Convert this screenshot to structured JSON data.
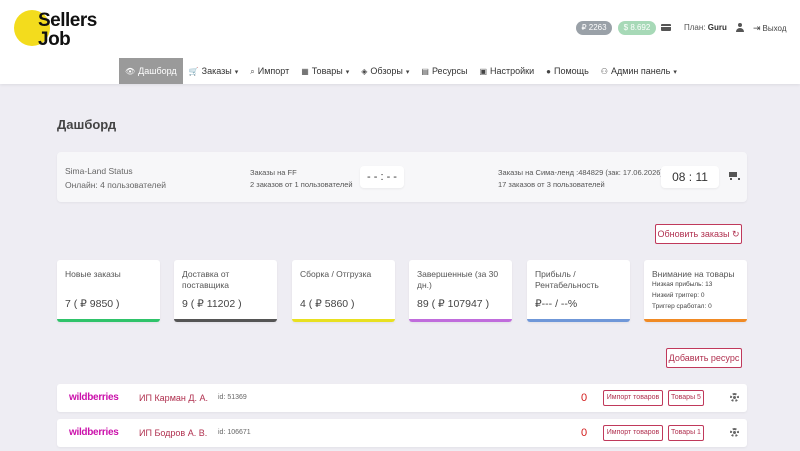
{
  "header": {
    "logo_line1": "Sellers",
    "logo_line2": "Job",
    "balance_gray": "₽ 2263",
    "balance_green": "$ 8.692",
    "plan_label": "План:",
    "plan_value": "Guru",
    "logout_label": "Выход"
  },
  "nav": [
    {
      "label": "Дашборд",
      "icon": "eye-icon",
      "active": true
    },
    {
      "label": "Заказы",
      "icon": "cart-icon",
      "dropdown": true
    },
    {
      "label": "Импорт",
      "icon": "search-icon"
    },
    {
      "label": "Товары",
      "icon": "grid-icon",
      "dropdown": true
    },
    {
      "label": "Обзоры",
      "icon": "tag-icon",
      "dropdown": true
    },
    {
      "label": "Ресурсы",
      "icon": "list-icon"
    },
    {
      "label": "Настройки",
      "icon": "settings-icon"
    },
    {
      "label": "Помощь",
      "icon": "help-icon"
    },
    {
      "label": "Админ панель",
      "icon": "users-icon",
      "dropdown": true
    }
  ],
  "page": {
    "title": "Дашборд"
  },
  "status": {
    "title": "Sima-Land Status",
    "online": "Онлайн: 4 пользователей",
    "ff_title": "Заказы на FF",
    "ff_sub": "2 заказов от 1 пользователей",
    "ff_clock": "- - : - -",
    "sima_title": "Заказы на Сима-ленд :484829 (зак: 17.06.2026)",
    "sima_sub": "17 заказов от 3 пользователей",
    "sima_clock": "08 : 11"
  },
  "buttons": {
    "refresh": "Обновить заказы",
    "add_resource": "Добавить ресурс"
  },
  "stats": [
    {
      "label": "Новые заказы",
      "value": "7 ( ₽ 9850 )",
      "color": "#2fc36a"
    },
    {
      "label": "Доставка от поставщика",
      "value": "9 ( ₽ 11202 )",
      "color": "#555555"
    },
    {
      "label": "Сборка / Отгрузка",
      "value": "4 ( ₽ 5860 )",
      "color": "#e8e020"
    },
    {
      "label": "Завершенные (за 30 дн.)",
      "value": "89 ( ₽ 107947 )",
      "color": "#c06cdc"
    },
    {
      "label": "Прибыль / Рентабельность",
      "value": "₽--- / --%",
      "color": "#6f97d8"
    },
    {
      "label": "Внимание на товары",
      "color": "#f08a24",
      "lines": [
        "Низкая прибыль: 13",
        "Низкий триггер: 0",
        "Триггер сработал: 0"
      ]
    }
  ],
  "resources": [
    {
      "brand": "wildberries",
      "name": "ИП Карман Д. А.",
      "id": "id: 51369",
      "count": "0",
      "import_label": "Импорт товаров",
      "goods_label": "Товары 5"
    },
    {
      "brand": "wildberries",
      "name": "ИП Бодров А. В.",
      "id": "id: 106671",
      "count": "0",
      "import_label": "Импорт товаров",
      "goods_label": "Товары 1"
    }
  ]
}
